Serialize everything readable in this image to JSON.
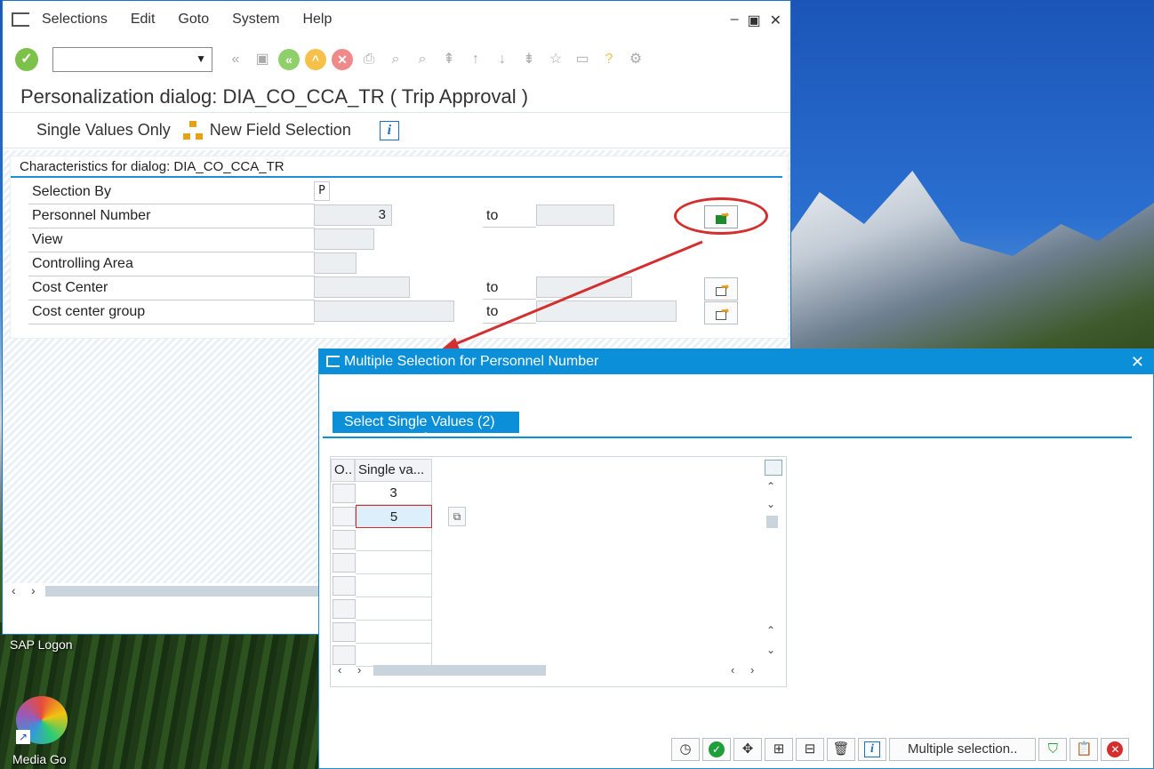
{
  "menu": {
    "items": [
      "Selections",
      "Edit",
      "Goto",
      "System",
      "Help"
    ]
  },
  "window": {
    "title": "Personalization dialog: DIA_CO_CCA_TR ( Trip Approval )"
  },
  "app_toolbar": {
    "single_values": "Single Values Only",
    "new_field_selection": "New Field Selection"
  },
  "group": {
    "title": "Characteristics for dialog: DIA_CO_CCA_TR",
    "rows": [
      {
        "label": "Selection By",
        "value": "P"
      },
      {
        "label": "Personnel Number",
        "value": "3",
        "to_label": "to",
        "to_value": ""
      },
      {
        "label": "View",
        "value": ""
      },
      {
        "label": "Controlling Area",
        "value": ""
      },
      {
        "label": "Cost Center",
        "value": "",
        "to_label": "to",
        "to_value": ""
      },
      {
        "label": "Cost center group",
        "value": "",
        "to_label": "to",
        "to_value": ""
      }
    ]
  },
  "desktop": {
    "sap_logon": "SAP Logon",
    "media_go": "Media Go"
  },
  "dialog": {
    "title": "Multiple Selection for Personnel Number",
    "tab": "Select Single Values (2)",
    "table": {
      "headers": [
        "O..",
        "Single va..."
      ],
      "values": [
        "3",
        "5",
        "",
        "",
        "",
        "",
        "",
        ""
      ]
    },
    "bottom": {
      "multiple_selection": "Multiple selection.."
    }
  },
  "colors": {
    "accent": "#0b8fd8",
    "annotation": "#d32f2f",
    "ok": "#1f9e3a"
  }
}
